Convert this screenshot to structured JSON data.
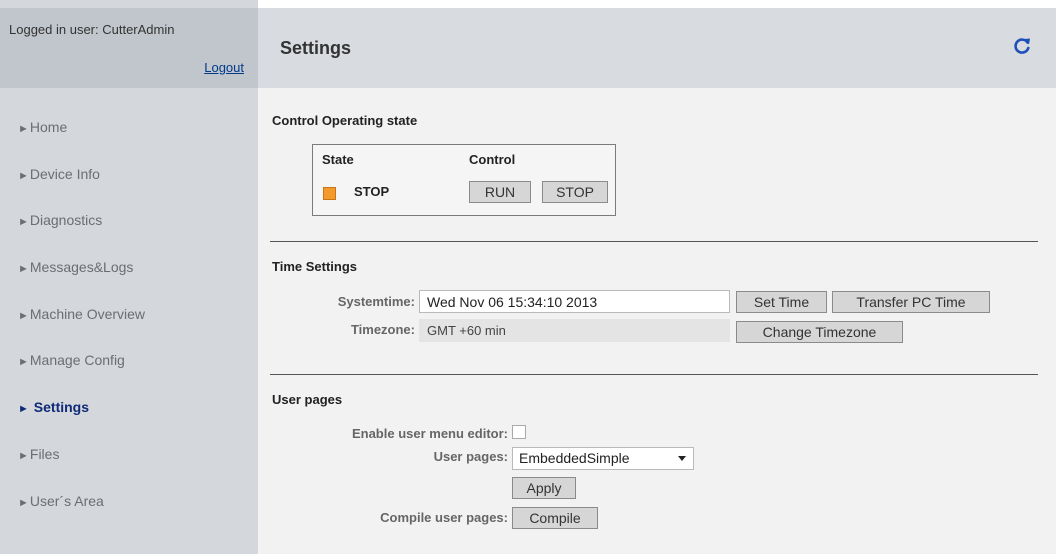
{
  "sidebar": {
    "logged_in_text": "Logged in user: CutterAdmin",
    "logout_label": "Logout",
    "nav_arrow": "►",
    "items": [
      {
        "label": "Home"
      },
      {
        "label": "Device Info"
      },
      {
        "label": "Diagnostics"
      },
      {
        "label": "Messages&Logs"
      },
      {
        "label": "Machine Overview"
      },
      {
        "label": "Manage Config"
      },
      {
        "label": "Settings",
        "active": true
      },
      {
        "label": "Files"
      },
      {
        "label": "User´s Area"
      }
    ]
  },
  "header": {
    "title": "Settings",
    "refresh_icon": "refresh-icon"
  },
  "operating_state": {
    "section_title": "Control Operating state",
    "col_state": "State",
    "col_control": "Control",
    "state_value": "STOP",
    "state_color": "#f39a2b",
    "run_label": "RUN",
    "stop_label": "STOP"
  },
  "time_settings": {
    "section_title": "Time Settings",
    "systemtime_label": "Systemtime:",
    "systemtime_value": "Wed Nov 06 15:34:10 2013",
    "set_time_label": "Set Time",
    "transfer_pc_time_label": "Transfer PC Time",
    "timezone_label": "Timezone:",
    "timezone_value": "GMT +60 min",
    "change_timezone_label": "Change Timezone"
  },
  "user_pages": {
    "section_title": "User pages",
    "enable_editor_label": "Enable user menu editor:",
    "enable_editor_checked": false,
    "user_pages_label": "User pages:",
    "user_pages_selected": "EmbeddedSimple",
    "apply_label": "Apply",
    "compile_label_text": "Compile user pages:",
    "compile_button_label": "Compile"
  }
}
